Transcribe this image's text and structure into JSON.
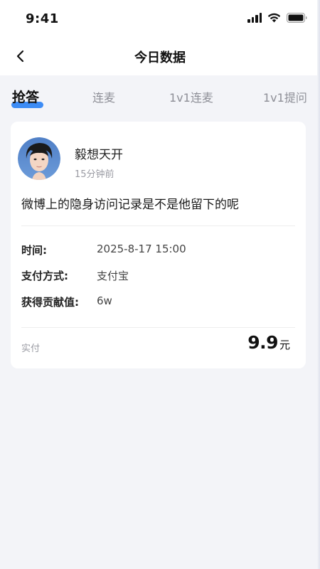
{
  "status_bar": {
    "time": "9:41"
  },
  "nav": {
    "title": "今日数据",
    "back_icon": "chevron-left-icon"
  },
  "tabs": [
    {
      "label": "抢答",
      "active": true
    },
    {
      "label": "连麦",
      "active": false
    },
    {
      "label": "1v1连麦",
      "active": false
    },
    {
      "label": "1v1提问",
      "active": false
    }
  ],
  "card": {
    "user_name": "毅想天开",
    "post_time": "15分钟前",
    "question": "微博上的隐身访问记录是不是他留下的呢",
    "details": [
      {
        "label": "时间:",
        "value": "2025-8-17 15:00"
      },
      {
        "label": "支付方式:",
        "value": "支付宝"
      },
      {
        "label": "获得贡献值:",
        "value": "6w"
      }
    ],
    "paid_label": "实付",
    "amount": "9.9",
    "amount_unit": "元"
  },
  "colors": {
    "accent": "#3d8cf5",
    "background": "#f3f4f8",
    "card": "#ffffff"
  }
}
